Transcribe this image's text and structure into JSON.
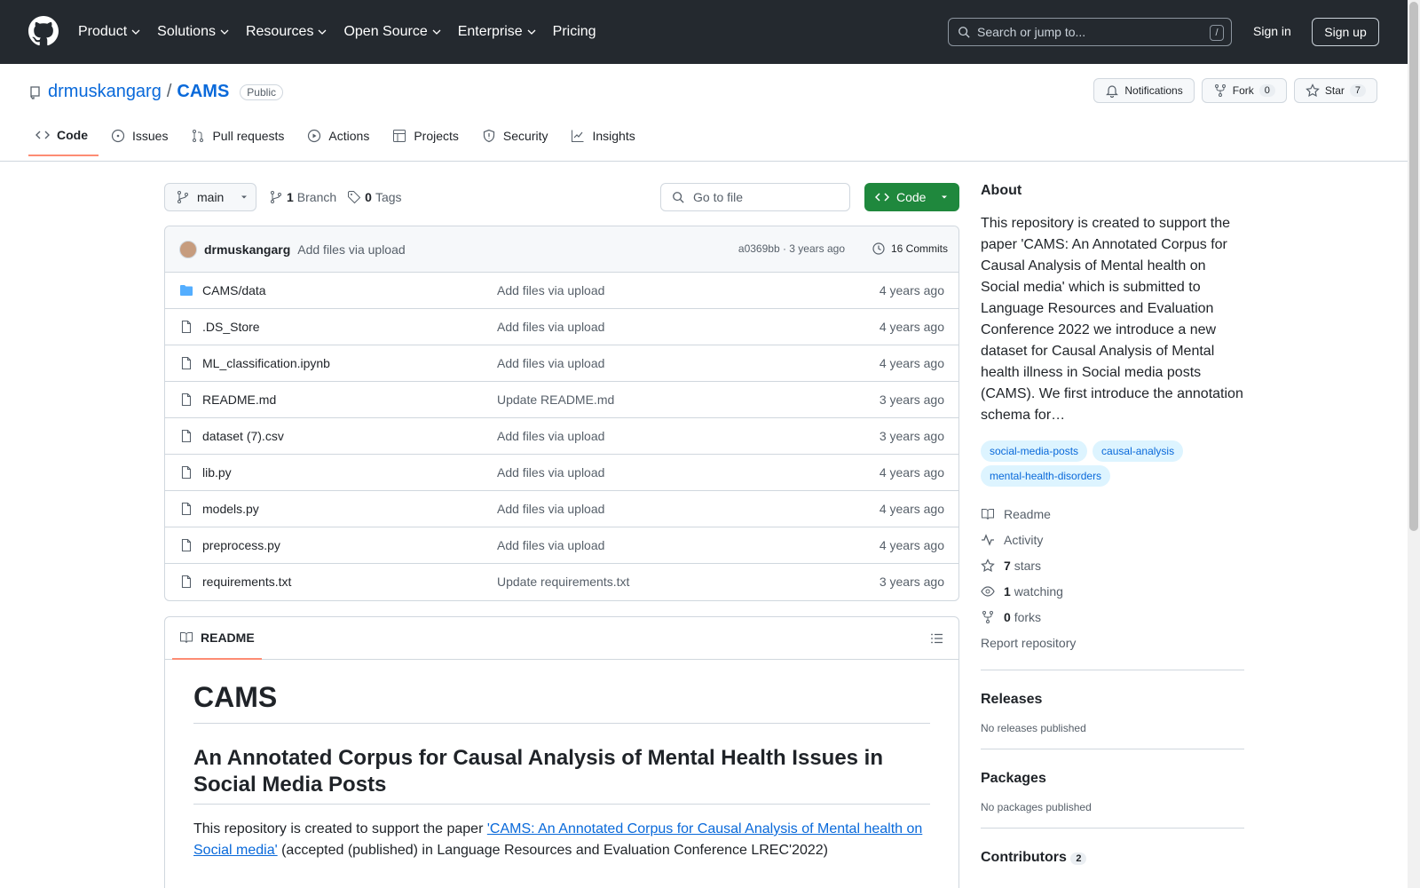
{
  "header": {
    "nav": [
      "Product",
      "Solutions",
      "Resources",
      "Open Source",
      "Enterprise",
      "Pricing"
    ],
    "search_placeholder": "Search or jump to...",
    "search_shortcut": "/",
    "signin": "Sign in",
    "signup": "Sign up"
  },
  "repo": {
    "owner": "drmuskangarg",
    "separator": "/",
    "name": "CAMS",
    "visibility": "Public",
    "notifications": "Notifications",
    "fork": "Fork",
    "fork_count": "0",
    "star": "Star",
    "star_count": "7",
    "tabs": [
      "Code",
      "Issues",
      "Pull requests",
      "Actions",
      "Projects",
      "Security",
      "Insights"
    ]
  },
  "toolbar": {
    "branch": "main",
    "branch_count": "1",
    "branch_label": "Branch",
    "tag_count": "0",
    "tag_label": "Tags",
    "goto_placeholder": "Go to file",
    "code_button": "Code"
  },
  "commit": {
    "author": "drmuskangarg",
    "message": "Add files via upload",
    "meta": "a0369bb · 3 years ago",
    "count": "16 Commits"
  },
  "files": [
    {
      "name": "CAMS/data",
      "type": "folder",
      "message": "Add files via upload",
      "date": "4 years ago"
    },
    {
      "name": ".DS_Store",
      "type": "file",
      "message": "Add files via upload",
      "date": "4 years ago"
    },
    {
      "name": "ML_classification.ipynb",
      "type": "file",
      "message": "Add files via upload",
      "date": "4 years ago"
    },
    {
      "name": "README.md",
      "type": "file",
      "message": "Update README.md",
      "date": "3 years ago"
    },
    {
      "name": "dataset (7).csv",
      "type": "file",
      "message": "Add files via upload",
      "date": "3 years ago"
    },
    {
      "name": "lib.py",
      "type": "file",
      "message": "Add files via upload",
      "date": "4 years ago"
    },
    {
      "name": "models.py",
      "type": "file",
      "message": "Add files via upload",
      "date": "4 years ago"
    },
    {
      "name": "preprocess.py",
      "type": "file",
      "message": "Add files via upload",
      "date": "4 years ago"
    },
    {
      "name": "requirements.txt",
      "type": "file",
      "message": "Update requirements.txt",
      "date": "3 years ago"
    }
  ],
  "readme": {
    "tab": "README",
    "h1": "CAMS",
    "h2": "An Annotated Corpus for Causal Analysis of Mental Health Issues in Social Media Posts",
    "p_before": "This repository is created to support the paper ",
    "p_link": "'CAMS: An Annotated Corpus for Causal Analysis of Mental health on Social media'",
    "p_after": " (accepted (published) in Language Resources and Evaluation Conference LREC'2022)"
  },
  "sidebar": {
    "about_title": "About",
    "about_text": "This repository is created to support the paper 'CAMS: An Annotated Corpus for Causal Analysis of Mental health on Social media' which is submitted to Language Resources and Evaluation Conference 2022 we introduce a new dataset for Causal Analysis of Mental health illness in Social media posts (CAMS). We first introduce the annotation schema for…",
    "topics": [
      "social-media-posts",
      "causal-analysis",
      "mental-health-disorders"
    ],
    "readme": "Readme",
    "activity": "Activity",
    "stars_n": "7",
    "stars": "stars",
    "watching_n": "1",
    "watching": "watching",
    "forks_n": "0",
    "forks": "forks",
    "report": "Report repository",
    "releases_title": "Releases",
    "releases_text": "No releases published",
    "packages_title": "Packages",
    "packages_text": "No packages published",
    "contributors_title": "Contributors",
    "contributors_count": "2"
  }
}
